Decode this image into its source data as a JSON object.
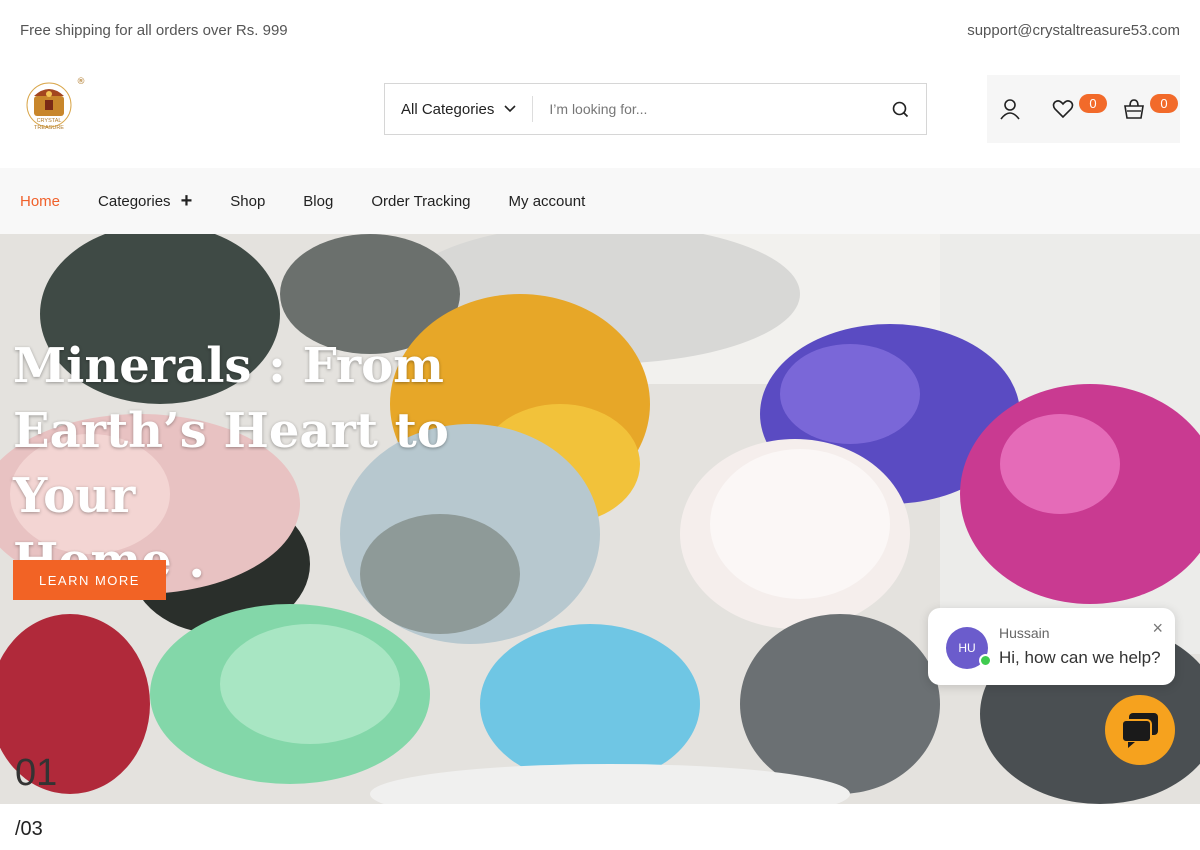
{
  "topbar": {
    "shipping_text": "Free shipping for all orders over Rs. 999",
    "email": "support@crystaltreasure53.com"
  },
  "logo": {
    "text_line1": "CRYSTAL",
    "text_line2": "TREASURE",
    "registered": "®"
  },
  "search": {
    "category_label": "All Categories",
    "placeholder": "I’m looking for..."
  },
  "header_icons": {
    "wishlist_count": "0",
    "cart_count": "0"
  },
  "nav": {
    "items": [
      {
        "label": "Home"
      },
      {
        "label": "Categories"
      },
      {
        "label": "Shop"
      },
      {
        "label": "Blog"
      },
      {
        "label": "Order Tracking"
      },
      {
        "label": "My account"
      }
    ],
    "categories_plus": "+"
  },
  "hero": {
    "title_line1": "Minerals : From",
    "title_line2": "Earth’s Heart to Your",
    "title_line3": "Home .",
    "cta_label": "LEARN MORE",
    "slide_current": "01",
    "slide_total": "/03"
  },
  "chat": {
    "avatar_initials": "HU",
    "agent_name": "Hussain",
    "message": "Hi, how can we help?",
    "close_symbol": "×"
  },
  "colors": {
    "accent": "#f26325",
    "badge": "#f26a2a",
    "chat_button": "#f6a21e",
    "avatar": "#6b5ccc"
  }
}
